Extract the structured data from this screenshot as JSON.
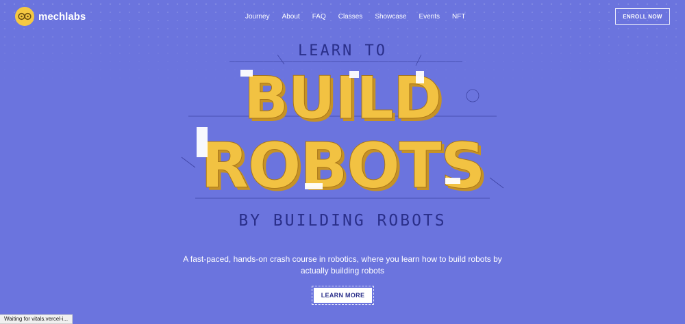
{
  "brand": {
    "name": "mechlabs",
    "logo_icon": "owl-eyes-icon",
    "logo_color": "#f5c842"
  },
  "nav": {
    "items": [
      "Journey",
      "About",
      "FAQ",
      "Classes",
      "Showcase",
      "Events",
      "NFT"
    ],
    "enroll_label": "ENROLL NOW"
  },
  "hero": {
    "top_line": "LEARN TO",
    "word1": "BUILD",
    "word2": "ROBOTS",
    "bottom_line": "BY BUILDING ROBOTS",
    "description": "A fast-paced, hands-on crash course in robotics, where you learn how to build robots by actually building robots",
    "cta_label": "LEARN MORE",
    "letter_color": "#f2c242",
    "background": "#6b74de"
  },
  "status_bar": {
    "text": "Waiting for vitals.vercel-i..."
  }
}
